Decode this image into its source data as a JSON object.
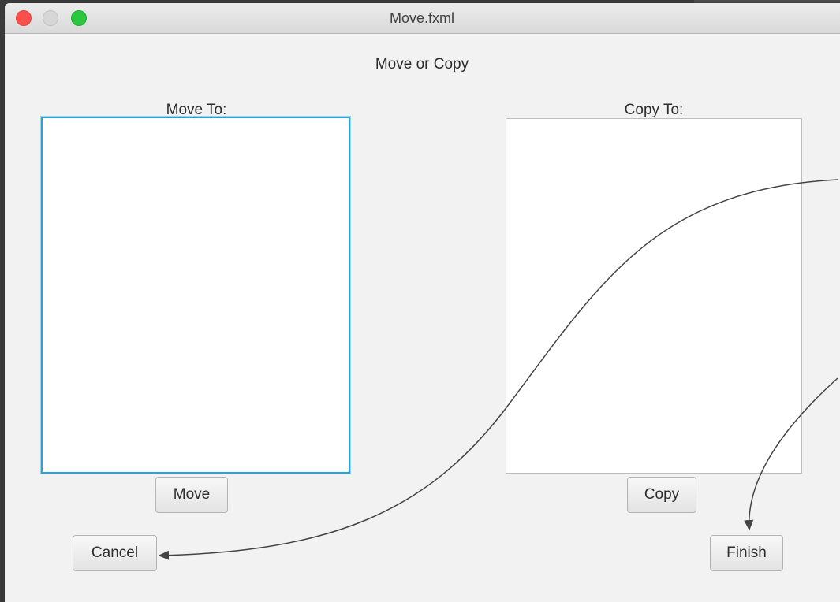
{
  "window": {
    "title": "Move.fxml"
  },
  "dialog": {
    "heading": "Move or Copy",
    "move_label": "Move To:",
    "copy_label": "Copy To:",
    "move_button": "Move",
    "copy_button": "Copy",
    "cancel_button": "Cancel",
    "finish_button": "Finish"
  },
  "colors": {
    "focus_border": "#2ba3d7",
    "close": "#fc4e4b",
    "zoom": "#2ac73f"
  }
}
